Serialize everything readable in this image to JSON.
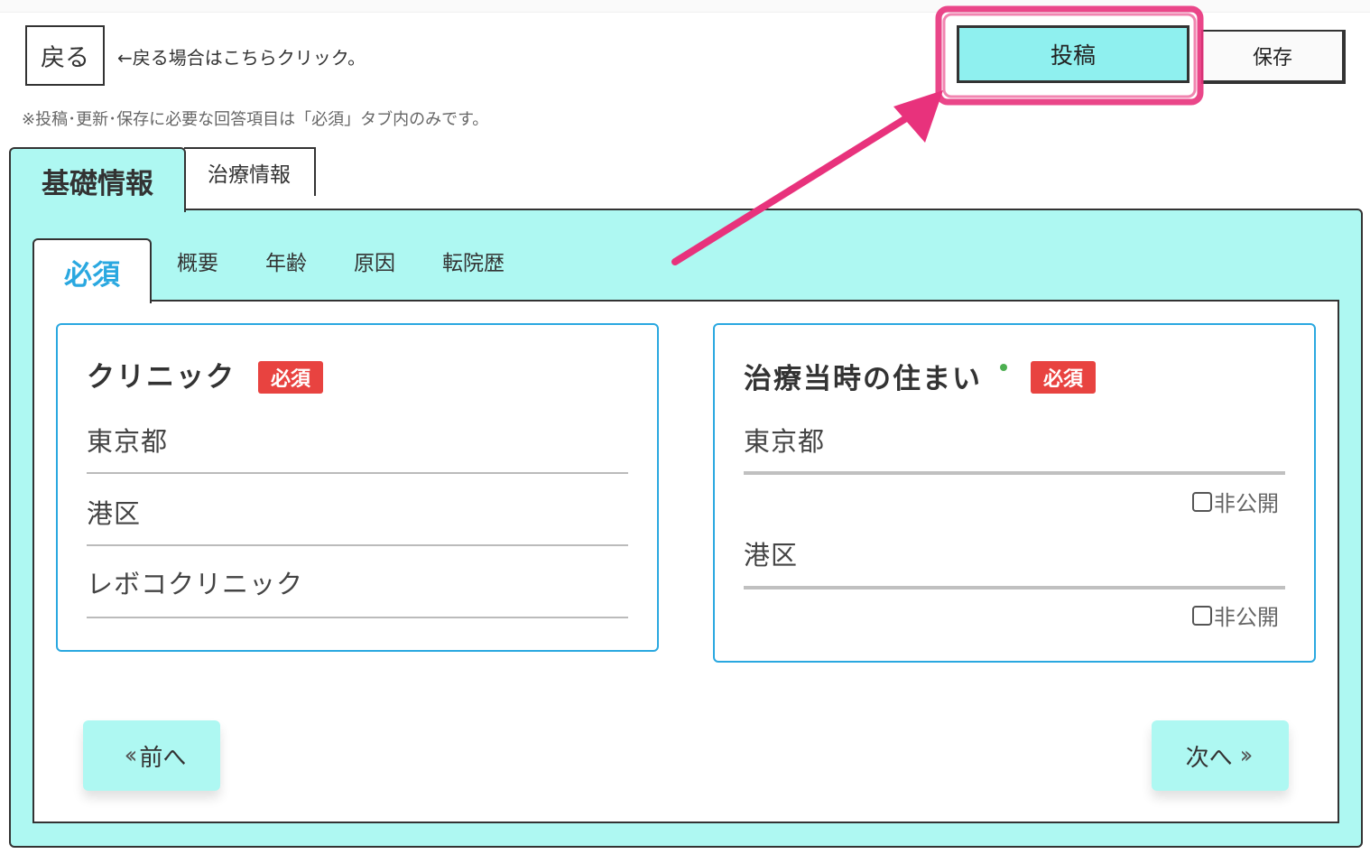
{
  "header": {
    "back_label": "戻る",
    "back_hint": "←戻る場合はこちらクリック。",
    "note": "※投稿･更新･保存に必要な回答項目は「必須」タブ内のみです。",
    "post_label": "投稿",
    "save_label": "保存"
  },
  "tabs": {
    "main": [
      {
        "label": "基礎情報",
        "active": true
      },
      {
        "label": "治療情報",
        "active": false
      }
    ],
    "sub": [
      {
        "label": "必須",
        "active": true
      },
      {
        "label": "概要"
      },
      {
        "label": "年齢"
      },
      {
        "label": "原因"
      },
      {
        "label": "転院歴"
      }
    ]
  },
  "clinic_card": {
    "title": "クリニック",
    "badge": "必須",
    "fields": [
      "東京都",
      "港区",
      "レボコクリニック"
    ]
  },
  "residence_card": {
    "title": "治療当時の住まい",
    "badge": "必須",
    "fields": [
      {
        "value": "東京都",
        "private_label": "非公開",
        "private_checked": false
      },
      {
        "value": "港区",
        "private_label": "非公開",
        "private_checked": false
      }
    ]
  },
  "navigation": {
    "prev_label": "前へ",
    "next_label": "次へ"
  },
  "colors": {
    "accent_cyan": "#8ff0ef",
    "panel_bg": "#aef8f2",
    "card_border": "#2aa8e0",
    "badge_red": "#e84340",
    "annotation_pink": "#e8327c"
  }
}
